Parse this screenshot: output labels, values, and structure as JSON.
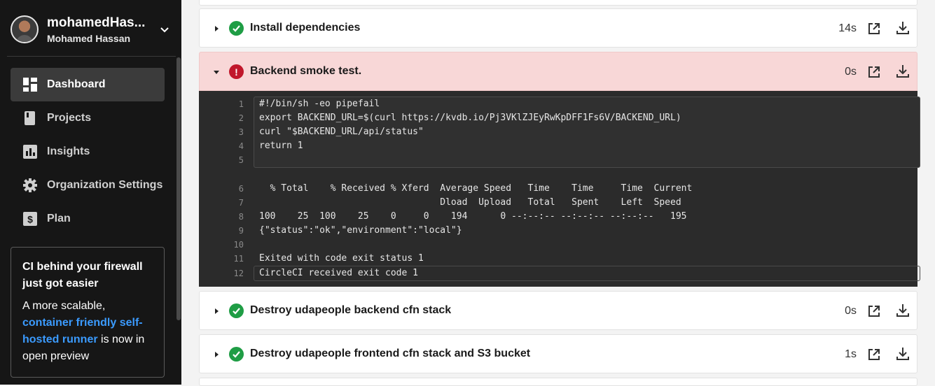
{
  "user": {
    "username": "mohamedHas...",
    "full_name": "Mohamed Hassan"
  },
  "nav": [
    {
      "label": "Dashboard",
      "icon": "dashboard-icon",
      "active": true
    },
    {
      "label": "Projects",
      "icon": "projects-icon",
      "active": false
    },
    {
      "label": "Insights",
      "icon": "insights-icon",
      "active": false
    },
    {
      "label": "Organization Settings",
      "icon": "gear-icon",
      "active": false
    },
    {
      "label": "Plan",
      "icon": "plan-icon",
      "active": false
    }
  ],
  "promo": {
    "title": "CI behind your firewall just got easier",
    "body_start": "A more scalable,",
    "link": "container friendly self-hosted runner",
    "body_end": "is now in open preview"
  },
  "steps": [
    {
      "title": "Install dependencies",
      "duration": "14s",
      "status": "success"
    },
    {
      "title": "Backend smoke test.",
      "duration": "0s",
      "status": "failed"
    },
    {
      "title": "Destroy udapeople backend cfn stack",
      "duration": "0s",
      "status": "success"
    },
    {
      "title": "Destroy udapeople frontend cfn stack and S3 bucket",
      "duration": "1s",
      "status": "success"
    }
  ],
  "terminal": {
    "lines": [
      {
        "n": "1",
        "text": "#!/bin/sh -eo pipefail"
      },
      {
        "n": "2",
        "text": "export BACKEND_URL=$(curl https://kvdb.io/Pj3VKlZJEyRwKpDFF1Fs6V/BACKEND_URL)"
      },
      {
        "n": "3",
        "text": "curl \"$BACKEND_URL/api/status\""
      },
      {
        "n": "4",
        "text": "return 1"
      },
      {
        "n": "5",
        "text": ""
      },
      {
        "n": "6",
        "text": "  % Total    % Received % Xferd  Average Speed   Time    Time     Time  Current"
      },
      {
        "n": "7",
        "text": "                                 Dload  Upload   Total   Spent    Left  Speed"
      },
      {
        "n": "8",
        "text": "100    25  100    25    0     0    194      0 --:--:-- --:--:-- --:--:--   195"
      },
      {
        "n": "9",
        "text": "{\"status\":\"ok\",\"environment\":\"local\"}"
      },
      {
        "n": "10",
        "text": ""
      },
      {
        "n": "11",
        "text": "Exited with code exit status 1"
      },
      {
        "n": "12",
        "text": "CircleCI received exit code 1"
      }
    ]
  },
  "colors": {
    "success": "#1f9d45",
    "failed": "#c1172b",
    "failed_bg": "#f8d7d7",
    "link": "#3b9bff"
  }
}
